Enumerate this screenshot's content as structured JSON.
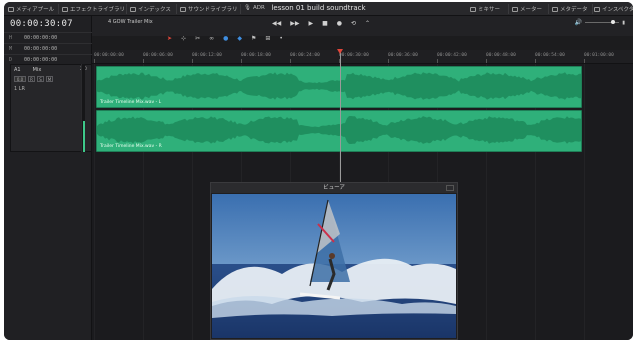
{
  "window": {
    "title": "lesson 01 build soundtrack"
  },
  "topbar": {
    "left_items": [
      {
        "label": "メディアプール",
        "icon": "media-pool-icon"
      },
      {
        "label": "エフェクトライブラリ",
        "icon": "effects-icon"
      },
      {
        "label": "インデックス",
        "icon": "index-icon"
      },
      {
        "label": "サウンドライブラリ",
        "icon": "sound-library-icon"
      },
      {
        "label": "ADR",
        "icon": "adr-icon"
      }
    ],
    "right_items": [
      {
        "label": "ミキサー",
        "icon": "mixer-icon"
      },
      {
        "label": "メーター",
        "icon": "meters-icon"
      },
      {
        "label": "メタデータ",
        "icon": "metadata-icon"
      },
      {
        "label": "インスペクタ",
        "icon": "inspector-icon"
      }
    ]
  },
  "timeline_header": {
    "timecode": "00:00:30:07",
    "rows": [
      {
        "label": "H",
        "value": "00:00:00:00"
      },
      {
        "label": "M",
        "value": "00:00:00:00"
      },
      {
        "label": "D",
        "value": "00:00:00:00"
      }
    ],
    "timeline_name": "4 GOW Trailer Mix"
  },
  "track": {
    "id": "A1",
    "name": "Mix",
    "level": "2.0",
    "volume": "0.0",
    "buttons": [
      "R",
      "S",
      "M"
    ],
    "channel": "1 LR",
    "meter_level": 0.35
  },
  "transport": {
    "buttons": [
      "rewind-icon",
      "fast-forward-icon",
      "play-icon",
      "stop-icon",
      "record-icon",
      "loop-icon"
    ]
  },
  "ruler": {
    "ticks": [
      "00:00:00:00",
      "00:00:06:00",
      "00:00:12:00",
      "00:00:18:00",
      "00:00:24:00",
      "00:00:30:00",
      "00:00:36:00",
      "00:00:42:00",
      "00:00:48:00",
      "00:00:54:00",
      "00:01:00:00"
    ]
  },
  "clips": [
    {
      "label": "Trailer Timeline Mix.wav - L"
    },
    {
      "label": "Trailer Timeline Mix.wav - R"
    }
  ],
  "viewer": {
    "title": "ビューア"
  },
  "colors": {
    "clip": "#2fb07a",
    "playhead": "#e0463a",
    "accent": "#3f8ee0"
  }
}
